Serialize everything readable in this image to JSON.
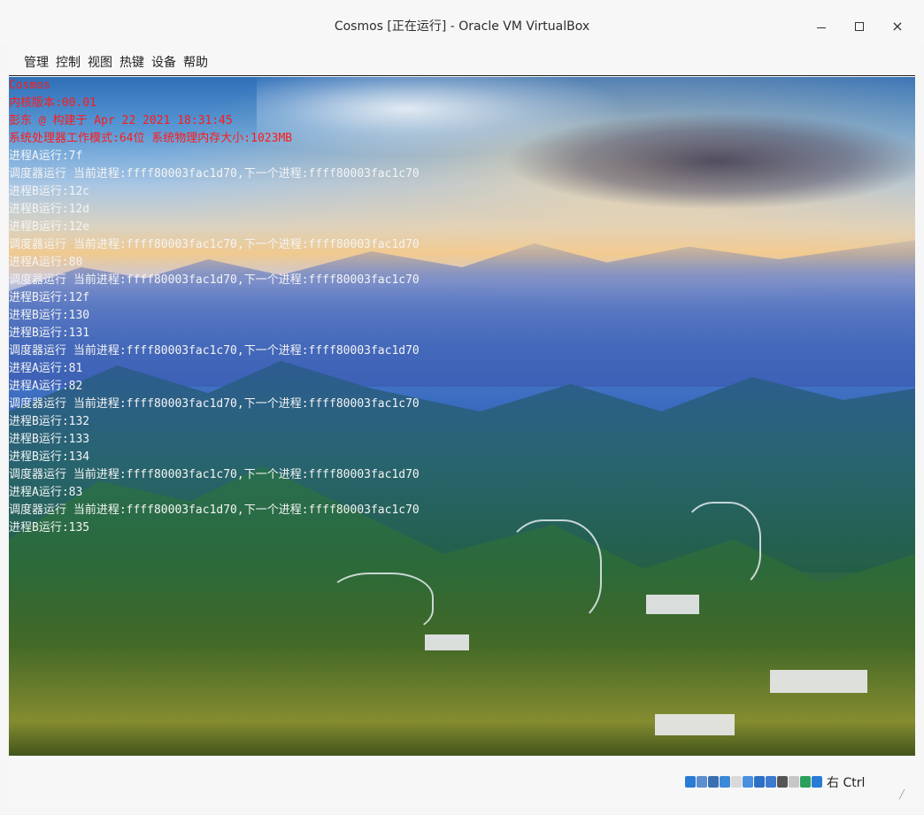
{
  "window": {
    "title": "Cosmos [正在运行] - Oracle VM VirtualBox",
    "minimize_glyph": "",
    "maximize_glyph": "",
    "close_glyph": "×"
  },
  "menu": [
    {
      "label": "管理"
    },
    {
      "label": "控制"
    },
    {
      "label": "视图"
    },
    {
      "label": "热键"
    },
    {
      "label": "设备"
    },
    {
      "label": "帮助"
    }
  ],
  "console": {
    "lines": [
      {
        "text": "Cosmos",
        "color": "red"
      },
      {
        "text": "内核版本:00.01",
        "color": "red"
      },
      {
        "text": "彭东 @ 构建于 Apr 22 2021 18:31:45",
        "color": "red"
      },
      {
        "text": "系统处理器工作模式:64位 系统物理内存大小:1023MB",
        "color": "red"
      },
      {
        "text": "进程A运行:7f",
        "color": "white"
      },
      {
        "text": "调度器运行 当前进程:ffff80003fac1d70,下一个进程:ffff80003fac1c70",
        "color": "white"
      },
      {
        "text": "进程B运行:12c",
        "color": "white"
      },
      {
        "text": "进程B运行:12d",
        "color": "white"
      },
      {
        "text": "进程B运行:12e",
        "color": "white"
      },
      {
        "text": "调度器运行 当前进程:ffff80003fac1c70,下一个进程:ffff80003fac1d70",
        "color": "white"
      },
      {
        "text": "进程A运行:80",
        "color": "white"
      },
      {
        "text": "调度器运行 当前进程:ffff80003fac1d70,下一个进程:ffff80003fac1c70",
        "color": "white"
      },
      {
        "text": "进程B运行:12f",
        "color": "white"
      },
      {
        "text": "进程B运行:130",
        "color": "white"
      },
      {
        "text": "进程B运行:131",
        "color": "white"
      },
      {
        "text": "调度器运行 当前进程:ffff80003fac1c70,下一个进程:ffff80003fac1d70",
        "color": "white"
      },
      {
        "text": "进程A运行:81",
        "color": "white"
      },
      {
        "text": "进程A运行:82",
        "color": "white"
      },
      {
        "text": "调度器运行 当前进程:ffff80003fac1d70,下一个进程:ffff80003fac1c70",
        "color": "white"
      },
      {
        "text": "进程B运行:132",
        "color": "white"
      },
      {
        "text": "进程B运行:133",
        "color": "white"
      },
      {
        "text": "进程B运行:134",
        "color": "white"
      },
      {
        "text": "调度器运行 当前进程:ffff80003fac1c70,下一个进程:ffff80003fac1d70",
        "color": "white"
      },
      {
        "text": "进程A运行:83",
        "color": "white"
      },
      {
        "text": "调度器运行 当前进程:ffff80003fac1d70,下一个进程:ffff80003fac1c70",
        "color": "white"
      },
      {
        "text": "进程B运行:135",
        "color": "white"
      }
    ]
  },
  "statusbar": {
    "icons": [
      {
        "name": "hard-disk-icon",
        "color": "#2a7bd4"
      },
      {
        "name": "optical-drive-icon",
        "color": "#5b8fd0"
      },
      {
        "name": "audio-icon",
        "color": "#3b6fb0"
      },
      {
        "name": "network-icon",
        "color": "#3a8ad8"
      },
      {
        "name": "usb-icon",
        "color": "#d9d9d9"
      },
      {
        "name": "shared-folders-icon",
        "color": "#4a90e0"
      },
      {
        "name": "display-icon",
        "color": "#2d6fc4"
      },
      {
        "name": "video-capture-icon",
        "color": "#3c7ad0"
      },
      {
        "name": "mouse-integration-icon",
        "color": "#555555"
      },
      {
        "name": "guest-additions-icon",
        "color": "#c7c7c7"
      },
      {
        "name": "cpu-icon",
        "color": "#2aa05a"
      },
      {
        "name": "keyboard-capture-icon",
        "color": "#2a7bd4"
      }
    ],
    "host_key": "右 Ctrl"
  }
}
